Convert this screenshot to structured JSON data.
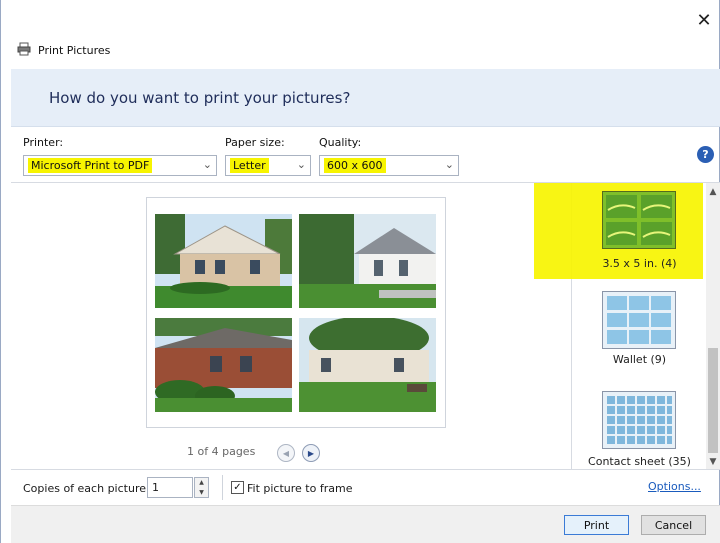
{
  "window": {
    "title": "Print Pictures",
    "close_glyph": "✕",
    "printer_icon": "printer-icon",
    "help_glyph": "?"
  },
  "header": {
    "question": "How do you want to print your pictures?"
  },
  "printer": {
    "label": "Printer:",
    "value": "Microsoft Print to PDF"
  },
  "paper": {
    "label": "Paper size:",
    "value": "Letter"
  },
  "quality": {
    "label": "Quality:",
    "value": "600 x 600"
  },
  "preview": {
    "pages": "1 of 4 pages"
  },
  "layouts": [
    {
      "label": "3.5 x 5 in. (4)",
      "selected": true
    },
    {
      "label": "Wallet (9)",
      "selected": false
    },
    {
      "label": "Contact sheet (35)",
      "selected": false
    }
  ],
  "copies": {
    "label": "Copies of each picture:",
    "value": "1"
  },
  "fit": {
    "label": "Fit picture to frame",
    "checked": true
  },
  "options_link": "Options...",
  "buttons": {
    "print": "Print",
    "cancel": "Cancel"
  },
  "colors": {
    "highlight": "#f7f400",
    "header_band": "#e6eef8",
    "link": "#1a5bbd",
    "brick": "#9a4e36",
    "grass": "#3f8a2e",
    "sky": "#cfe3f2"
  }
}
